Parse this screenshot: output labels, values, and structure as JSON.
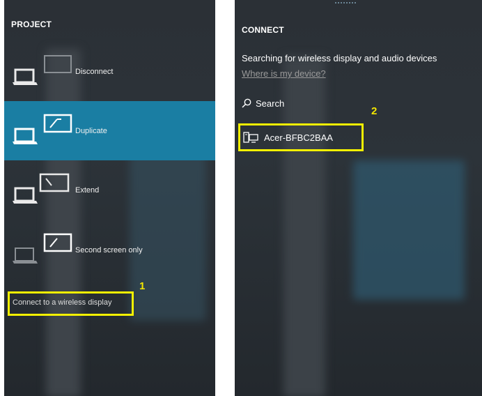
{
  "project": {
    "title": "PROJECT",
    "items": [
      {
        "label": "Disconnect",
        "icon": "laptop-with-disabled-screen-icon"
      },
      {
        "label": "Duplicate",
        "icon": "duplicate-screens-icon"
      },
      {
        "label": "Extend",
        "icon": "extend-screens-icon"
      },
      {
        "label": "Second screen only",
        "icon": "second-screen-only-icon"
      }
    ],
    "selected_index": 1,
    "wireless_link": "Connect to a wireless display",
    "step_number": "1"
  },
  "connect": {
    "title": "CONNECT",
    "status": "Searching for wireless display and audio devices",
    "help_link": "Where is my device?",
    "search_label": "Search",
    "device_name": "Acer-BFBC2BAA",
    "step_number": "2"
  },
  "colors": {
    "panel_bg": "#2b3036",
    "selected_bg": "#1a7ea3",
    "highlight_box": "#f4f000",
    "step_number": "#f4e600"
  }
}
